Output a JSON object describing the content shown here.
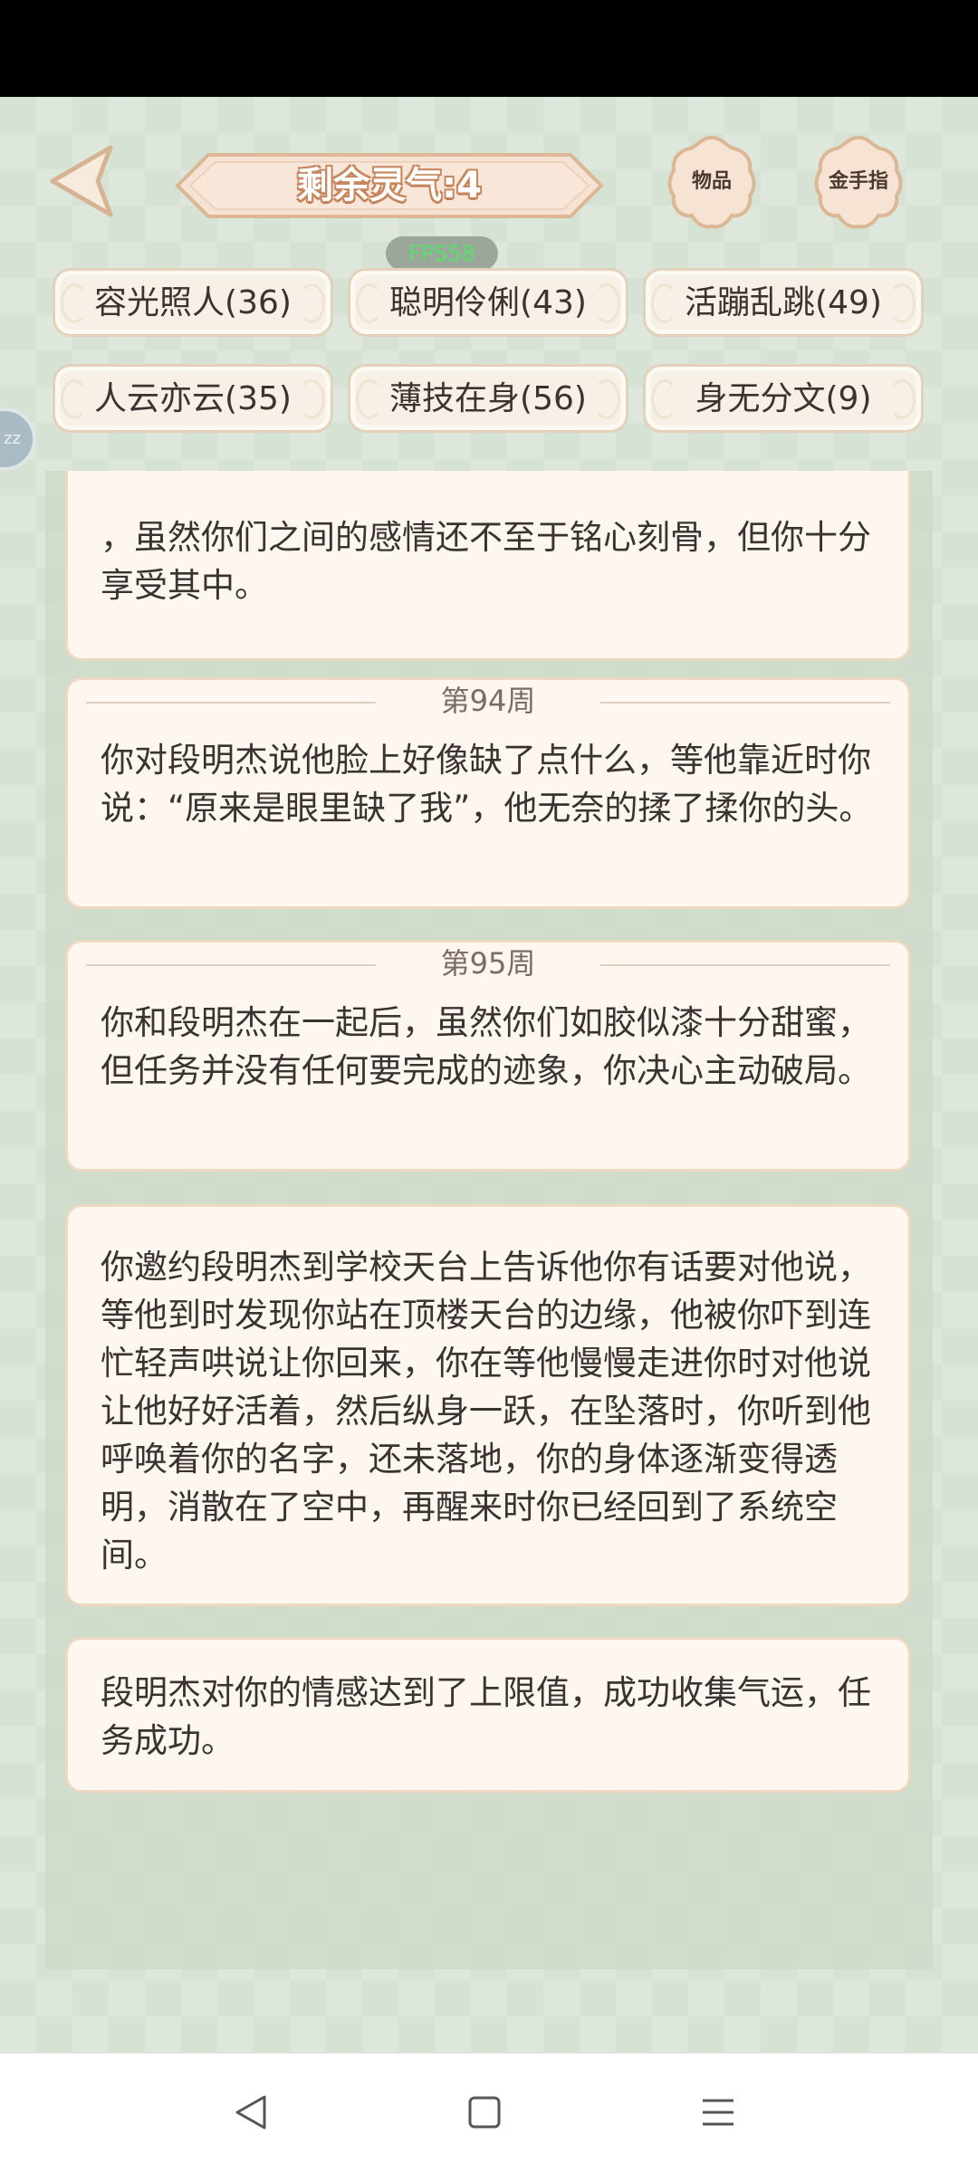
{
  "header": {
    "spirit_label": "剩余灵气:4",
    "items_button": "物品",
    "cheat_button": "金手指",
    "fps": "FPS58"
  },
  "side_bubble": {
    "label": "zz"
  },
  "attributes": [
    {
      "label": "容光照人(36)"
    },
    {
      "label": "聪明伶俐(43)"
    },
    {
      "label": "活蹦乱跳(49)"
    },
    {
      "label": "人云亦云(35)"
    },
    {
      "label": "薄技在身(56)"
    },
    {
      "label": "身无分文(9)"
    }
  ],
  "log": [
    {
      "week": "",
      "text": "，虽然你们之间的感情还不至于铭心刻骨，但你十分享受其中。"
    },
    {
      "week": "第94周",
      "text": "你对段明杰说他脸上好像缺了点什么，等他靠近时你说：“原来是眼里缺了我”，他无奈的揉了揉你的头。"
    },
    {
      "week": "第95周",
      "text": "你和段明杰在一起后，虽然你们如胶似漆十分甜蜜，但任务并没有任何要完成的迹象，你决心主动破局。"
    },
    {
      "week": "",
      "text": "你邀约段明杰到学校天台上告诉他你有话要对他说，等他到时发现你站在顶楼天台的边缘，他被你吓到连忙轻声哄说让你回来，你在等他慢慢走进你时对他说让他好好活着，然后纵身一跃，在坠落时，你听到他呼唤着你的名字，还未落地，你的身体逐渐变得透明，消散在了空中，再醒来时你已经回到了系统空间。"
    },
    {
      "week": "",
      "text": "段明杰对你的情感达到了上限值，成功收集气运，任务成功。"
    }
  ],
  "colors": {
    "background": "#d6e2d3",
    "card": "#fdf7f0",
    "banner": "#f6e2d2",
    "text": "#3a3330"
  }
}
